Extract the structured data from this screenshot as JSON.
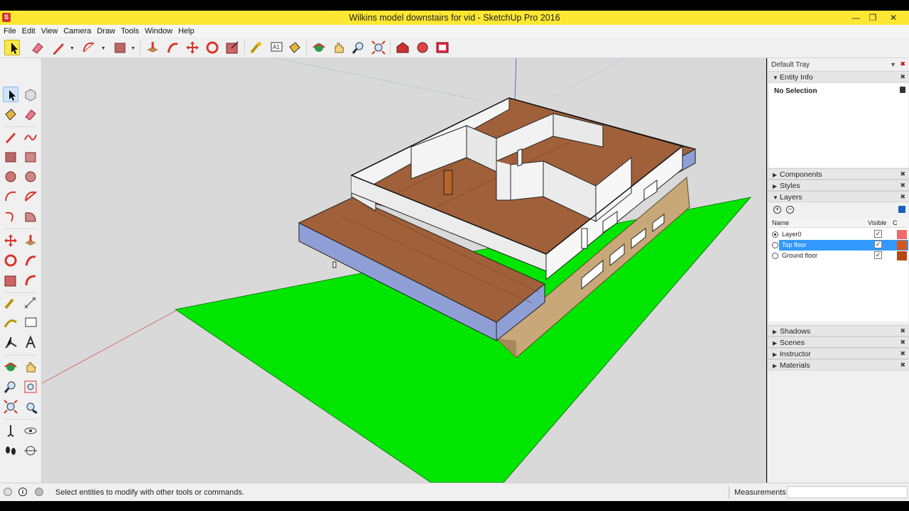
{
  "window": {
    "title": "Wilkins model downstairs for vid - SketchUp Pro 2016",
    "app_icon": "sketchup-logo-icon"
  },
  "menu": [
    "File",
    "Edit",
    "View",
    "Camera",
    "Draw",
    "Tools",
    "Window",
    "Help"
  ],
  "toolbar_icons": [
    "select-icon",
    "eraser-icon",
    "pencil-icon",
    "arc-icon",
    "rectangle-icon",
    "push-pull-icon",
    "follow-me-icon",
    "move-icon",
    "rotate-icon",
    "scale-icon",
    "tape-measure-icon",
    "text-icon",
    "paint-bucket-icon",
    "orbit-icon",
    "pan-icon",
    "zoom-icon",
    "zoom-extents-icon",
    "warehouse-icon",
    "extension-warehouse-icon",
    "layout-icon"
  ],
  "tray": {
    "title": "Default Tray",
    "entity_info": {
      "header": "Entity Info",
      "selection": "No Selection"
    },
    "components": "Components",
    "styles": "Styles",
    "layers": {
      "header": "Layers",
      "col_name": "Name",
      "col_visible": "Visible",
      "col_color": "C",
      "rows": [
        {
          "name": "Layer0",
          "active": true,
          "selected": false,
          "visible": true,
          "color": "#f36a6a"
        },
        {
          "name": "Top floor",
          "active": false,
          "selected": true,
          "visible": true,
          "color": "#d6561a"
        },
        {
          "name": "Ground floor",
          "active": false,
          "selected": false,
          "visible": true,
          "color": "#b8460f"
        }
      ]
    },
    "shadows": "Shadows",
    "scenes": "Scenes",
    "instructor": "Instructor",
    "materials": "Materials"
  },
  "status": {
    "text": "Select entities to modify with other tools or commands.",
    "measurements_label": "Measurements",
    "measurements_value": ""
  },
  "colors": {
    "titlebar": "#fde733",
    "ground": "#00e600",
    "floor": "#a0603a",
    "glass": "#8f9fd6",
    "selection": "#3399ff"
  }
}
